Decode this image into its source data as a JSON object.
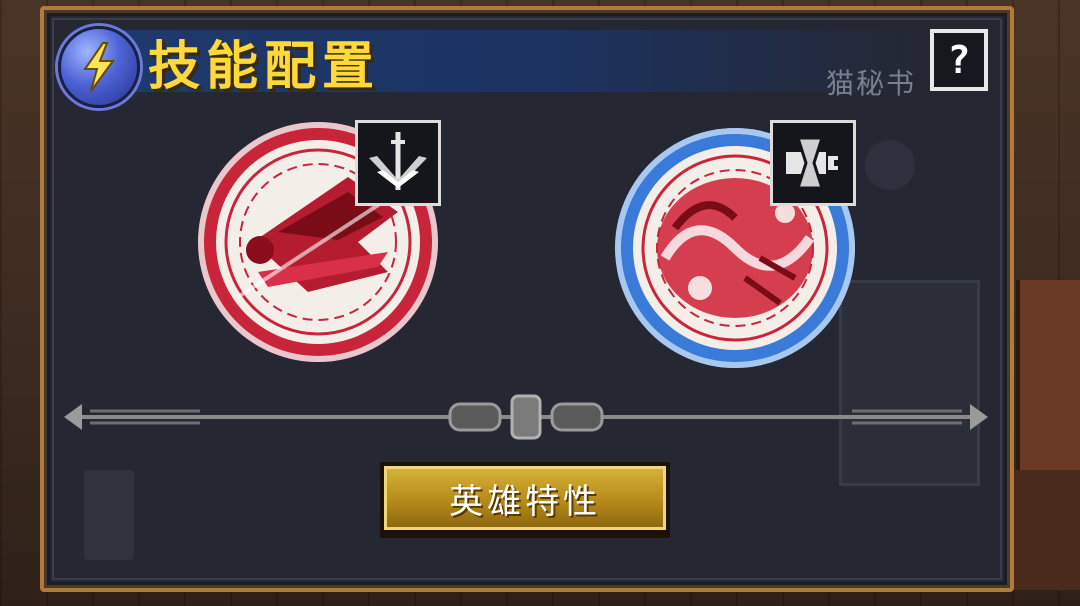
{
  "header": {
    "title": "技能配置",
    "help_label": "?",
    "npc_label": "猫秘书"
  },
  "skills": [
    {
      "slot": 1,
      "ring_color": "#c8243a",
      "type_icon": "sword-fan-icon"
    },
    {
      "slot": 2,
      "ring_color": "#3a7ad8",
      "type_icon": "hourglass-cannon-icon"
    }
  ],
  "actions": {
    "hero_traits_label": "英雄特性"
  },
  "colors": {
    "panel_bg": "#252833",
    "panel_border": "#b37a3c",
    "title_color": "#ffd83a",
    "button_gold": "#c9a02a"
  }
}
